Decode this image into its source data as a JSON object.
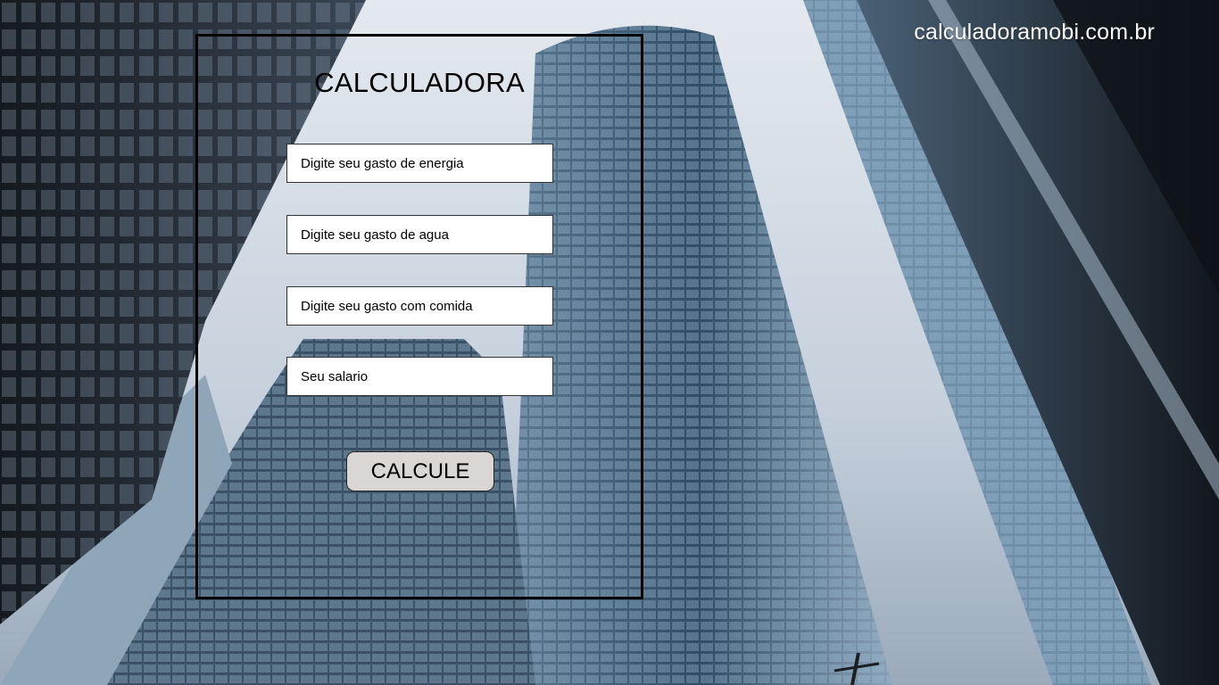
{
  "site": {
    "url_text": "calculadoramobi.com.br"
  },
  "calculator": {
    "title": "CALCULADORA",
    "fields": {
      "energia": {
        "placeholder": "Digite seu gasto de energia",
        "value": ""
      },
      "agua": {
        "placeholder": "Digite seu gasto de agua",
        "value": ""
      },
      "comida": {
        "placeholder": "Digite seu gasto com comida",
        "value": ""
      },
      "salario": {
        "placeholder": "Seu salario",
        "value": ""
      }
    },
    "button_label": "CALCULE"
  },
  "colors": {
    "panel_border": "#000000",
    "button_bg": "#d9d6d4",
    "url_text": "#ffffff"
  }
}
